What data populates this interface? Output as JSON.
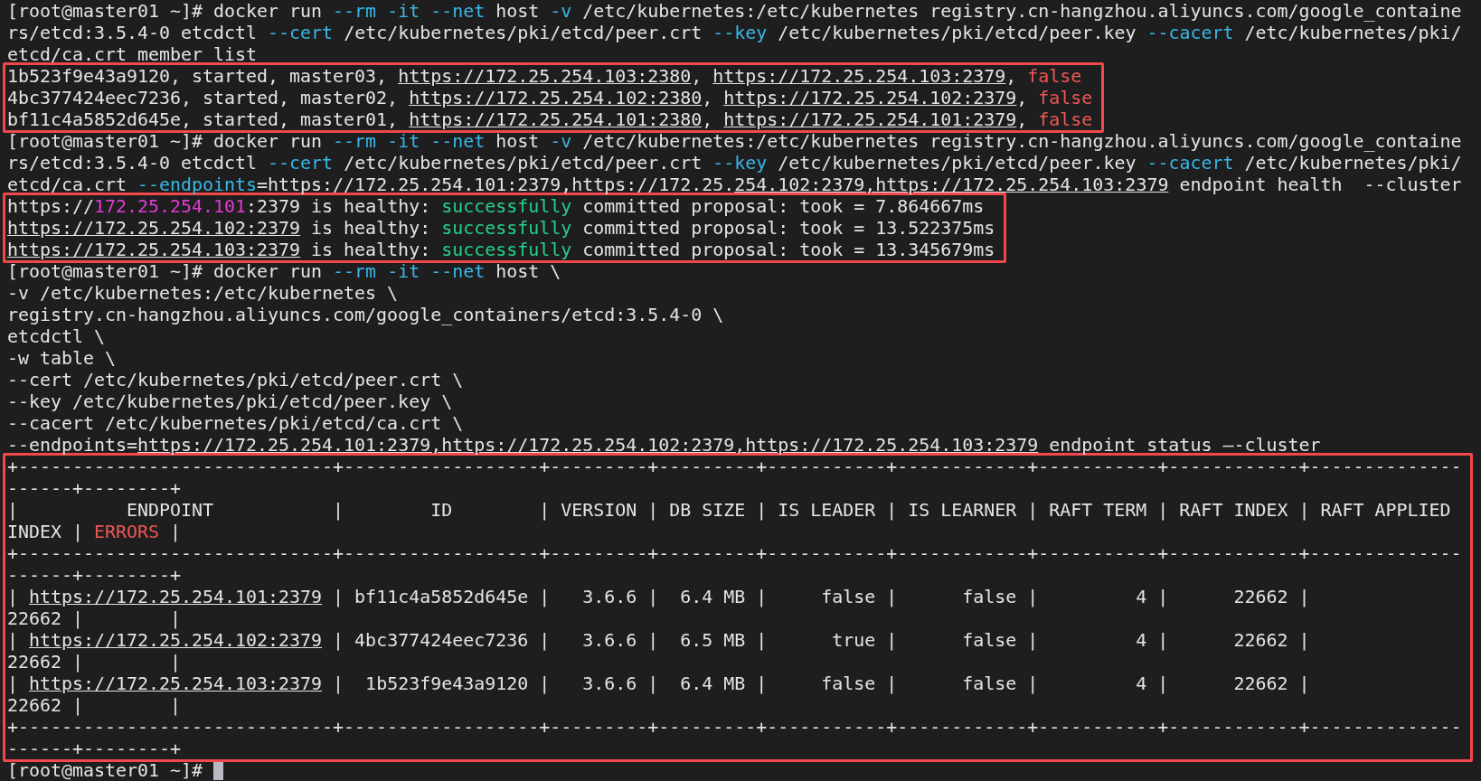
{
  "groups": [
    {
      "framed": false,
      "lines": [
        [
          {
            "kind": "plain",
            "text": "[root@master01 ~]# docker run "
          },
          {
            "kind": "flag",
            "text": "--rm -it --net"
          },
          {
            "kind": "plain",
            "text": " host "
          },
          {
            "kind": "flag",
            "text": "-v"
          },
          {
            "kind": "plain",
            "text": " /etc/kubernetes:/etc/kubernetes registry.cn-hangzhou.aliyuncs.com/google_containe"
          }
        ],
        [
          {
            "kind": "plain",
            "text": "rs/etcd:3.5.4-0 etcdctl "
          },
          {
            "kind": "flag",
            "text": "--cert"
          },
          {
            "kind": "plain",
            "text": " /etc/kubernetes/pki/etcd/peer.crt "
          },
          {
            "kind": "flag",
            "text": "--key"
          },
          {
            "kind": "plain",
            "text": " /etc/kubernetes/pki/etcd/peer.key "
          },
          {
            "kind": "flag",
            "text": "--cacert"
          },
          {
            "kind": "plain",
            "text": " /etc/kubernetes/pki/"
          }
        ],
        [
          {
            "kind": "plain",
            "text": "etcd/ca.crt member list"
          }
        ]
      ]
    },
    {
      "framed": true,
      "lines": [
        [
          {
            "kind": "plain",
            "text": "1b523f9e43a9120, started, master03, "
          },
          {
            "kind": "url",
            "text": "https://172.25.254.103:2380"
          },
          {
            "kind": "plain",
            "text": ", "
          },
          {
            "kind": "url",
            "text": "https://172.25.254.103:2379"
          },
          {
            "kind": "plain",
            "text": ", "
          },
          {
            "kind": "error",
            "text": "false"
          }
        ],
        [
          {
            "kind": "plain",
            "text": "4bc377424eec7236, started, master02, "
          },
          {
            "kind": "url",
            "text": "https://172.25.254.102:2380"
          },
          {
            "kind": "plain",
            "text": ", "
          },
          {
            "kind": "url",
            "text": "https://172.25.254.102:2379"
          },
          {
            "kind": "plain",
            "text": ", "
          },
          {
            "kind": "error",
            "text": "false"
          }
        ],
        [
          {
            "kind": "plain",
            "text": "bf11c4a5852d645e, started, master01, "
          },
          {
            "kind": "url",
            "text": "https://172.25.254.101:2380"
          },
          {
            "kind": "plain",
            "text": ", "
          },
          {
            "kind": "url",
            "text": "https://172.25.254.101:2379"
          },
          {
            "kind": "plain",
            "text": ", "
          },
          {
            "kind": "error",
            "text": "false"
          }
        ]
      ]
    },
    {
      "framed": false,
      "lines": [
        [
          {
            "kind": "plain",
            "text": "[root@master01 ~]# docker run "
          },
          {
            "kind": "flag",
            "text": "--rm -it --net"
          },
          {
            "kind": "plain",
            "text": " host "
          },
          {
            "kind": "flag",
            "text": "-v"
          },
          {
            "kind": "plain",
            "text": " /etc/kubernetes:/etc/kubernetes registry.cn-hangzhou.aliyuncs.com/google_containe"
          }
        ],
        [
          {
            "kind": "plain",
            "text": "rs/etcd:3.5.4-0 etcdctl "
          },
          {
            "kind": "flag",
            "text": "--cert"
          },
          {
            "kind": "plain",
            "text": " /etc/kubernetes/pki/etcd/peer.crt "
          },
          {
            "kind": "flag",
            "text": "--key"
          },
          {
            "kind": "plain",
            "text": " /etc/kubernetes/pki/etcd/peer.key "
          },
          {
            "kind": "flag",
            "text": "--cacert"
          },
          {
            "kind": "plain",
            "text": " /etc/kubernetes/pki/"
          }
        ],
        [
          {
            "kind": "plain",
            "text": "etcd/ca.crt "
          },
          {
            "kind": "flag",
            "text": "--endpoints"
          },
          {
            "kind": "plain",
            "text": "=https://172.25.254.101:2379,https://172.25."
          },
          {
            "kind": "url",
            "text": "254.102:2379,https://172.25.254.103:2379"
          },
          {
            "kind": "plain",
            "text": " endpoint health  --cluster"
          }
        ]
      ]
    },
    {
      "framed": true,
      "lines": [
        [
          {
            "kind": "plain",
            "text": "https://"
          },
          {
            "kind": "ip",
            "text": "172.25.254.101"
          },
          {
            "kind": "plain",
            "text": ":2379 is healthy: "
          },
          {
            "kind": "success",
            "text": "successfully"
          },
          {
            "kind": "plain",
            "text": " committed proposal: took = 7.864667ms"
          }
        ],
        [
          {
            "kind": "url",
            "text": "https://172.25.254.102:2379"
          },
          {
            "kind": "plain",
            "text": " is healthy: "
          },
          {
            "kind": "success",
            "text": "successfully"
          },
          {
            "kind": "plain",
            "text": " committed proposal: took = 13.522375ms"
          }
        ],
        [
          {
            "kind": "url",
            "text": "https://172.25.254.103:2379"
          },
          {
            "kind": "plain",
            "text": " is healthy: "
          },
          {
            "kind": "success",
            "text": "successfully"
          },
          {
            "kind": "plain",
            "text": " committed proposal: took = 13.345679ms"
          }
        ]
      ]
    },
    {
      "framed": false,
      "lines": [
        [
          {
            "kind": "plain",
            "text": "[root@master01 ~]# docker run "
          },
          {
            "kind": "flag",
            "text": "--rm -it --net"
          },
          {
            "kind": "plain",
            "text": " host \\"
          }
        ],
        [
          {
            "kind": "plain",
            "text": "-v /etc/kubernetes:/etc/kubernetes \\"
          }
        ],
        [
          {
            "kind": "plain",
            "text": "registry.cn-hangzhou.aliyuncs.com/google_containers/etcd:3.5.4-0 \\"
          }
        ],
        [
          {
            "kind": "plain",
            "text": "etcdctl \\"
          }
        ],
        [
          {
            "kind": "plain",
            "text": "-w table \\"
          }
        ],
        [
          {
            "kind": "plain",
            "text": "--cert /etc/kubernetes/pki/etcd/peer.crt \\"
          }
        ],
        [
          {
            "kind": "plain",
            "text": "--key /etc/kubernetes/pki/etcd/peer.key \\"
          }
        ],
        [
          {
            "kind": "plain",
            "text": "--cacert /etc/kubernetes/pki/etcd/ca.crt \\"
          }
        ],
        [
          {
            "kind": "plain",
            "text": "--endpoints="
          },
          {
            "kind": "url",
            "text": "https://172.25.254.101:2379,https://172.25.254.102:2379,https://172.25.254.103:2379"
          },
          {
            "kind": "plain",
            "text": " endpoint status —-cluster"
          }
        ]
      ]
    },
    {
      "framed": true,
      "lines": [
        [
          {
            "kind": "plain",
            "text": "+-----------------------------+------------------+---------+---------+-----------+------------+-----------+------------+--------------"
          }
        ],
        [
          {
            "kind": "plain",
            "text": "------+--------+"
          }
        ],
        [
          {
            "kind": "plain",
            "text": "|          ENDPOINT           |        ID        | VERSION | DB SIZE | IS LEADER | IS LEARNER | RAFT TERM | RAFT INDEX | RAFT APPLIED"
          }
        ],
        [
          {
            "kind": "plain",
            "text": "INDEX | "
          },
          {
            "kind": "error",
            "text": "ERRORS"
          },
          {
            "kind": "plain",
            "text": " |"
          }
        ],
        [
          {
            "kind": "plain",
            "text": "+-----------------------------+------------------+---------+---------+-----------+------------+-----------+------------+--------------"
          }
        ],
        [
          {
            "kind": "plain",
            "text": "------+--------+"
          }
        ],
        [
          {
            "kind": "plain",
            "text": "| "
          },
          {
            "kind": "url",
            "text": "https://172.25.254.101:2379"
          },
          {
            "kind": "plain",
            "text": " | bf11c4a5852d645e |   3.6.6 |  6.4 MB |     false |      false |         4 |      22662 |"
          }
        ],
        [
          {
            "kind": "plain",
            "text": "22662 |        |"
          }
        ],
        [
          {
            "kind": "plain",
            "text": "| "
          },
          {
            "kind": "url",
            "text": "https://172.25.254.102:2379"
          },
          {
            "kind": "plain",
            "text": " | 4bc377424eec7236 |   3.6.6 |  6.5 MB |      true |      false |         4 |      22662 |"
          }
        ],
        [
          {
            "kind": "plain",
            "text": "22662 |        |"
          }
        ],
        [
          {
            "kind": "plain",
            "text": "| "
          },
          {
            "kind": "url",
            "text": "https://172.25.254.103:2379"
          },
          {
            "kind": "plain",
            "text": " |  1b523f9e43a9120 |   3.6.6 |  6.4 MB |     false |      false |         4 |      22662 |"
          }
        ],
        [
          {
            "kind": "plain",
            "text": "22662 |        |"
          }
        ],
        [
          {
            "kind": "plain",
            "text": "+-----------------------------+------------------+---------+---------+-----------+------------+-----------+------------+--------------"
          }
        ],
        [
          {
            "kind": "plain",
            "text": "------+--------+"
          }
        ]
      ]
    }
  ],
  "prompt": {
    "text": "[root@master01 ~]#",
    "cursor": true
  }
}
